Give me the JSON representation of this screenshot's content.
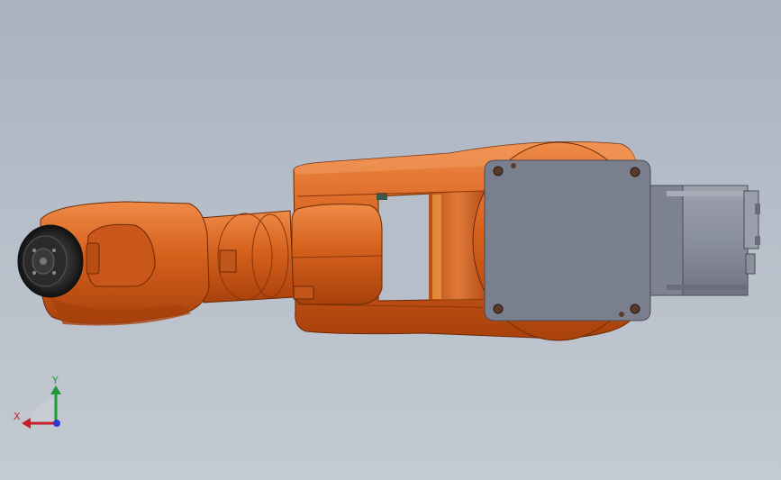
{
  "viewport": {
    "background_top": "#a8b2c0",
    "background_bottom": "#c4cad2"
  },
  "model": {
    "body_color": "#d5601c",
    "body_shadow": "#a9410c",
    "body_highlight": "#ef8a47",
    "motor_plate_color": "#7a7f8e",
    "motor_body_color": "#8d92a0",
    "flange_color": "#2b2b2b"
  },
  "triad": {
    "x_label": "X",
    "y_label": "Y",
    "x_color": "#c8202a",
    "y_color": "#1f9a3a",
    "z_color": "#2a3bd0"
  }
}
